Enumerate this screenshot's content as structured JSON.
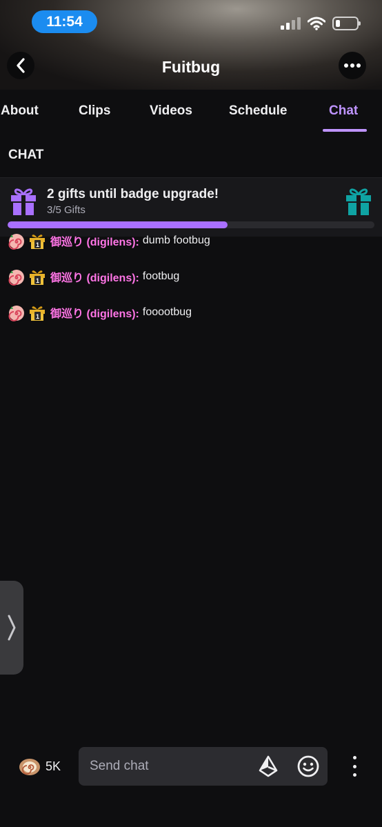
{
  "status_bar": {
    "time": "11:54",
    "icons": [
      "signal-icon",
      "wifi-icon",
      "battery-icon"
    ]
  },
  "header": {
    "title": "Fuitbug",
    "back_icon": "chevron-left-icon",
    "more_icon": "ellipsis-icon"
  },
  "tabs": [
    {
      "label": "About",
      "active": false
    },
    {
      "label": "Clips",
      "active": false
    },
    {
      "label": "Videos",
      "active": false
    },
    {
      "label": "Schedule",
      "active": false
    },
    {
      "label": "Chat",
      "active": true
    }
  ],
  "section_title": "CHAT",
  "gift_banner": {
    "title": "2 gifts until badge upgrade!",
    "count_text": "3/5 Gifts",
    "progress_fraction": 0.6,
    "colors": {
      "left_gift": "#a970ff",
      "right_gift": "#0fa3a3",
      "progress": "#a970ff"
    }
  },
  "messages": [
    {
      "username": "御巡り (digilens):",
      "text": "dumb footbug",
      "badges": [
        "swirl-roll-badge-icon",
        "gift-sub-badge-icon"
      ]
    },
    {
      "username": "御巡り (digilens):",
      "text": "footbug",
      "badges": [
        "swirl-roll-badge-icon",
        "gift-sub-badge-icon"
      ]
    },
    {
      "username": "御巡り (digilens):",
      "text": "fooootbug",
      "badges": [
        "swirl-roll-badge-icon",
        "gift-sub-badge-icon"
      ]
    }
  ],
  "bottom_bar": {
    "points_value": "5K",
    "input_placeholder": "Send chat",
    "icons": [
      "channel-points-icon",
      "bits-icon",
      "emote-icon",
      "kebab-menu-icon"
    ]
  },
  "colors": {
    "accent": "#bf94ff",
    "username": "#ff75e6",
    "background": "#0e0e10"
  }
}
